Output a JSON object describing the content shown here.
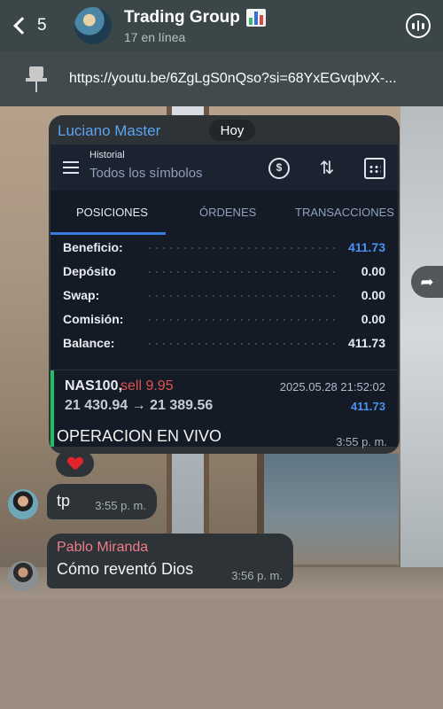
{
  "header": {
    "back_count": "5",
    "title": "Trading Group",
    "subtitle": "17 en línea"
  },
  "pinned": {
    "text": "https://youtu.be/6ZgLgS0nQso?si=68YxEGvqbvX-..."
  },
  "messages": {
    "main": {
      "sender": "Luciano Master",
      "date_pill": "Hoy",
      "caption": "OPERACION EN VIVO",
      "time": "3:55 p. m.",
      "reaction": "heart",
      "screenshot": {
        "small_title": "Historial",
        "main_title": "Todos los símbolos",
        "tabs": [
          "POSICIONES",
          "ÓRDENES",
          "TRANSACCIONES"
        ],
        "active_tab": "POSICIONES",
        "rows": [
          {
            "label": "Beneficio:",
            "value": "411.73"
          },
          {
            "label": "Depósito",
            "value": "0.00"
          },
          {
            "label": "Swap:",
            "value": "0.00"
          },
          {
            "label": "Comisión:",
            "value": "0.00"
          },
          {
            "label": "Balance:",
            "value": "411.73"
          }
        ],
        "deal": {
          "symbol": "NAS100,",
          "side": "sell 9.95",
          "prices": "21 430.94 → 21 389.56",
          "time": "2025.05.28 21:52:02",
          "profit": "411.73"
        }
      }
    },
    "tp": {
      "text": "tp",
      "time": "3:55 p. m."
    },
    "pablo": {
      "sender": "Pablo Miranda",
      "text": "Cómo reventó Dios",
      "time": "3:56 p. m."
    }
  },
  "colors": {
    "accent_blue": "#4d91ef",
    "sell_red": "#e2524a",
    "sender_blue": "#5aa4f0",
    "sender_pink": "#f07b8a"
  },
  "icons": {
    "back": "chevron-left-icon",
    "call": "voice-chat-icon",
    "pin": "pin-icon",
    "forward": "forward-icon"
  }
}
